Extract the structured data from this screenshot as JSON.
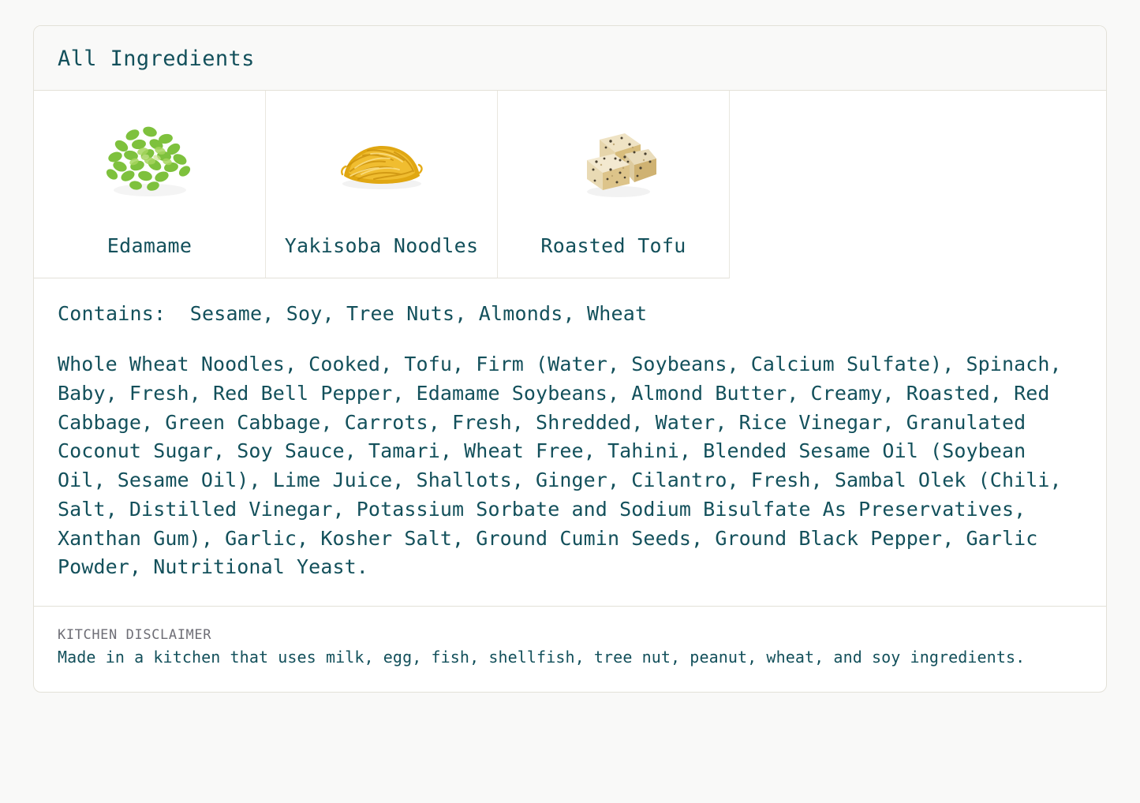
{
  "page": {
    "background_color": "#f9f9f8",
    "text_color": "#13505b",
    "muted_text_color": "#6e6e76",
    "border_color": "#e3e1d8"
  },
  "card": {
    "header": {
      "title": "All Ingredients"
    },
    "ingredients_grid": [
      {
        "label": "Edamame",
        "icon": "edamame-beans-image"
      },
      {
        "label": "Yakisoba Noodles",
        "icon": "yakisoba-noodles-image"
      },
      {
        "label": "Roasted Tofu",
        "icon": "roasted-tofu-image"
      }
    ],
    "allergens": {
      "label": "Contains:",
      "list": "Sesame, Soy, Tree Nuts, Almonds, Wheat",
      "full_line": "Contains:  Sesame, Soy, Tree Nuts, Almonds, Wheat",
      "items": [
        "Sesame",
        "Soy",
        "Tree Nuts",
        "Almonds",
        "Wheat"
      ]
    },
    "ingredient_statement": "Whole Wheat Noodles, Cooked, Tofu, Firm (Water, Soybeans, Calcium Sulfate), Spinach, Baby, Fresh, Red Bell Pepper, Edamame Soybeans, Almond Butter, Creamy, Roasted, Red Cabbage, Green Cabbage, Carrots, Fresh, Shredded, Water, Rice Vinegar, Granulated Coconut Sugar, Soy Sauce, Tamari, Wheat Free, Tahini, Blended Sesame Oil (Soybean Oil, Sesame Oil), Lime Juice, Shallots, Ginger, Cilantro, Fresh, Sambal Olek (Chili, Salt, Distilled Vinegar, Potassium Sorbate and Sodium Bisulfate As Preservatives, Xanthan Gum), Garlic, Kosher Salt, Ground Cumin Seeds, Ground Black Pepper, Garlic Powder, Nutritional Yeast.",
    "disclaimer": {
      "heading": "KITCHEN DISCLAIMER",
      "text": "Made in a kitchen that uses milk, egg, fish, shellfish, tree nut, peanut, wheat, and soy ingredients."
    }
  }
}
